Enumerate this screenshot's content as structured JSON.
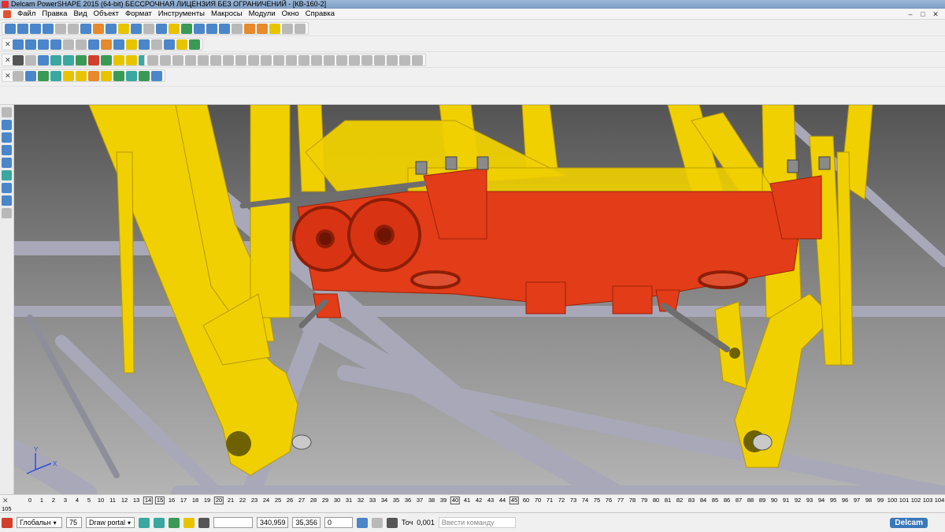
{
  "window": {
    "title": "Delcam PowerSHAPE 2015 (64-bit) БЕССРОЧНАЯ ЛИЦЕНЗИЯ БЕЗ ОГРАНИЧЕНИЙ - [КВ-160-2]",
    "minimize": "–",
    "restore": "□",
    "close": "✕"
  },
  "menu": [
    "Файл",
    "Правка",
    "Вид",
    "Объект",
    "Формат",
    "Инструменты",
    "Макросы",
    "Модули",
    "Окно",
    "Справка"
  ],
  "toolbars": {
    "close_glyph": "✕",
    "row1": [
      "c-b",
      "c-b",
      "c-b",
      "c-b",
      "c-gr",
      "c-gr",
      "c-b",
      "c-o",
      "c-b",
      "c-y",
      "c-b",
      "c-gr",
      "c-b",
      "c-y",
      "c-g",
      "c-b",
      "c-b",
      "c-b",
      "c-gr",
      "c-o",
      "c-o",
      "c-y",
      "c-gr",
      "c-gr",
      "c-b",
      "c-b",
      "c-t",
      "c-b",
      "c-b",
      "c-y",
      "c-t",
      "c-t",
      "c-y"
    ],
    "row2": [
      "c-dk",
      "c-gr",
      "c-b",
      "c-t",
      "c-t",
      "c-g",
      "c-r",
      "c-g",
      "c-y",
      "c-y",
      "c-t",
      "c-b",
      "c-t",
      "c-g",
      "c-y"
    ],
    "row2b": [
      "c-gr",
      "c-gr",
      "c-gr",
      "c-gr",
      "c-gr",
      "c-gr",
      "c-gr",
      "c-gr",
      "c-gr",
      "c-gr",
      "c-gr",
      "c-gr",
      "c-gr",
      "c-gr",
      "c-gr",
      "c-gr",
      "c-gr",
      "c-gr",
      "c-gr",
      "c-gr",
      "c-gr",
      "c-gr"
    ],
    "row3": [
      "c-gr",
      "c-b",
      "c-g",
      "c-t",
      "c-y",
      "c-y",
      "c-o",
      "c-y",
      "c-g",
      "c-t",
      "c-g",
      "c-b"
    ]
  },
  "viewport": {
    "axis_y": "Y",
    "axis_x": "X",
    "background_top": "#545454",
    "background_bottom": "#b4b4b4",
    "frame_color": "#f0d000",
    "beam_color": "#e23c18",
    "lattice_color": "#a8a8b8"
  },
  "ruler": {
    "close_glyph": "✕",
    "ticks": [
      "0",
      "1",
      "2",
      "3",
      "4",
      "5",
      "10",
      "11",
      "12",
      "13",
      "14",
      "15",
      "16",
      "17",
      "18",
      "19",
      "20",
      "21",
      "22",
      "23",
      "24",
      "25",
      "26",
      "27",
      "28",
      "29",
      "30",
      "31",
      "32",
      "33",
      "34",
      "35",
      "36",
      "37",
      "38",
      "39",
      "40",
      "41",
      "42",
      "43",
      "44",
      "45",
      "60",
      "70",
      "71",
      "72",
      "73",
      "74",
      "75",
      "76",
      "77",
      "78",
      "79",
      "80",
      "81",
      "82",
      "83",
      "84",
      "85",
      "86",
      "87",
      "88",
      "89",
      "90",
      "91",
      "92",
      "93",
      "94",
      "95",
      "96",
      "97",
      "98",
      "99",
      "100",
      "101",
      "102",
      "103",
      "104"
    ],
    "boxed": [
      "14",
      "15",
      "20",
      "40",
      "45"
    ],
    "tail": "105"
  },
  "status": {
    "workplane": "Глобальн",
    "level_number": "75",
    "level_name": "Draw portal",
    "coord_x": "340,959",
    "coord_y": "35,356",
    "coord_z": "0",
    "tolerance_label": "Точ",
    "tolerance_value": "0,001",
    "command_placeholder": "Ввести команду",
    "brand": "Delcam"
  }
}
